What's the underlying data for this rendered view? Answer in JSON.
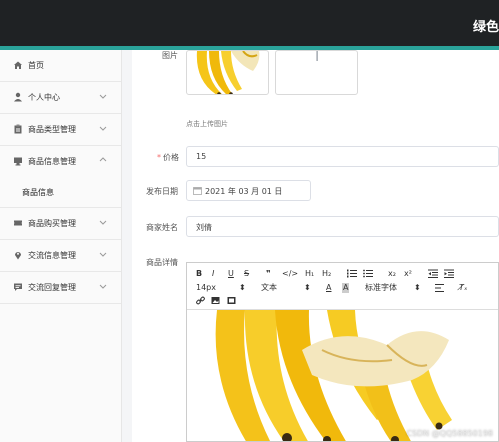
{
  "header": {
    "title": "绿色"
  },
  "sidebar": {
    "items": [
      {
        "label": "首页",
        "icon": "home-icon"
      },
      {
        "label": "个人中心",
        "icon": "user-icon"
      },
      {
        "label": "商品类型管理",
        "icon": "clipboard-icon"
      },
      {
        "label": "商品信息管理",
        "icon": "monitor-icon"
      },
      {
        "label": "商品信息",
        "icon": ""
      },
      {
        "label": "商品购买管理",
        "icon": "ticket-icon"
      },
      {
        "label": "交流信息管理",
        "icon": "location-icon"
      },
      {
        "label": "交流回复管理",
        "icon": "chat-icon"
      }
    ]
  },
  "form": {
    "image_label": "图片",
    "upload_hint": "点击上传图片",
    "price_required_mark": "*",
    "price_label": "价格",
    "price_value": "15",
    "date_label": "发布日期",
    "date_value": "2021 年 03 月 01 日",
    "merchant_label": "商家姓名",
    "merchant_value": "刘倩",
    "detail_label": "商品详情"
  },
  "editor": {
    "toolbar_row1": [
      "B",
      "I",
      "U",
      "S",
      "99",
      "</>",
      "H1",
      "H2",
      "ol",
      "ul",
      "x2",
      "x2sup",
      "outdent",
      "indent"
    ],
    "font_size": "14px",
    "text_style": "文本",
    "font_family": "标准字体",
    "h1": "H₁",
    "h2": "H₂",
    "sub": "x₂",
    "sup": "x²"
  },
  "watermark": "CSDN @QQ58850198",
  "colors": {
    "accent": "#2aa39a",
    "topbar": "#1f2224",
    "required": "#f56c6c"
  }
}
